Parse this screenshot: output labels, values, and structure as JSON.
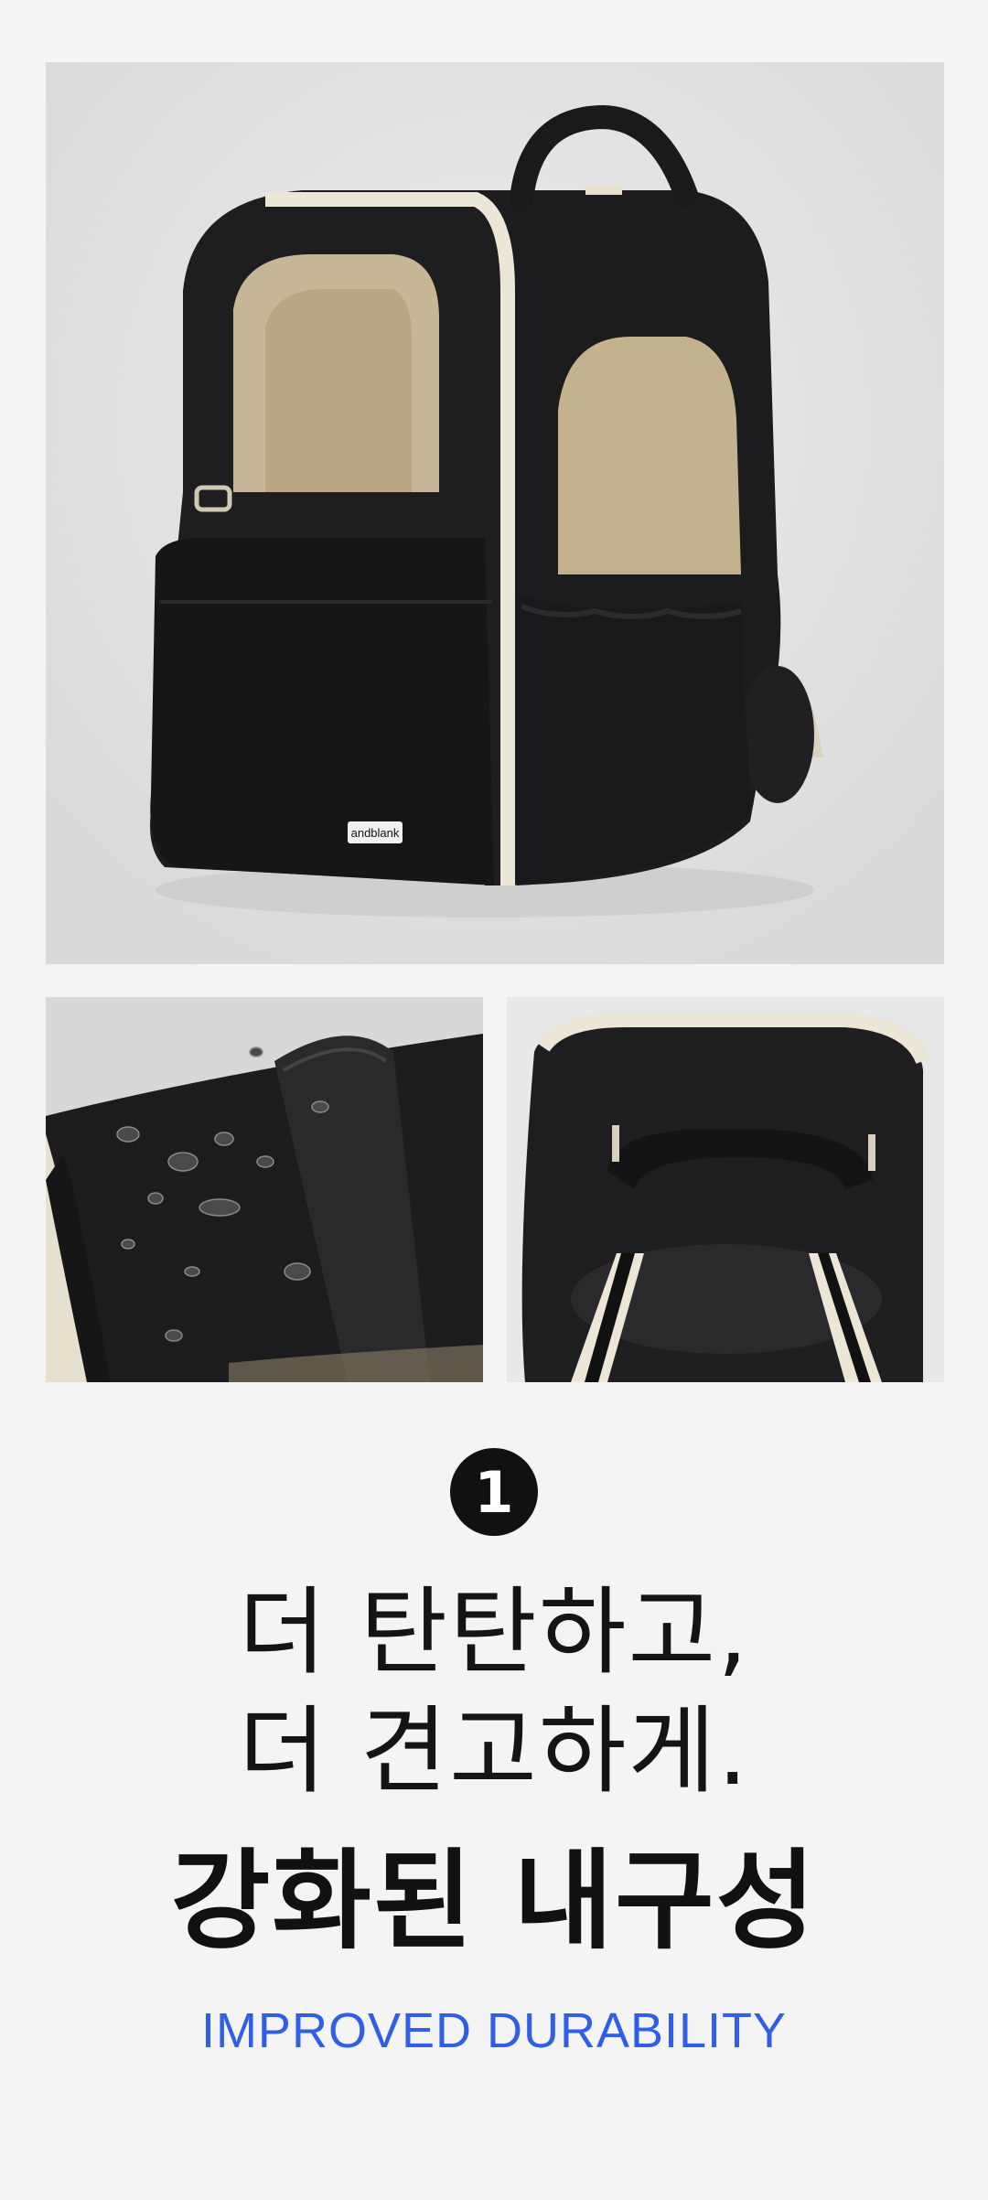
{
  "photos": {
    "hero": {
      "description_icon": "backpack-pet-carrier-photo",
      "brand_tag": "andblank"
    },
    "detail_left": {
      "description_icon": "water-droplets-fabric-photo"
    },
    "detail_right": {
      "description_icon": "backpack-top-handle-photo"
    }
  },
  "feature": {
    "number": "1",
    "headline_line1": "더 탄탄하고,",
    "headline_line2": "더 견고하게.",
    "title": "강화된 내구성",
    "subtitle": "IMPROVED DURABILITY"
  },
  "colors": {
    "background": "#f4f4f4",
    "accent_blue": "#2f5fe8",
    "text_dark": "#141414"
  }
}
